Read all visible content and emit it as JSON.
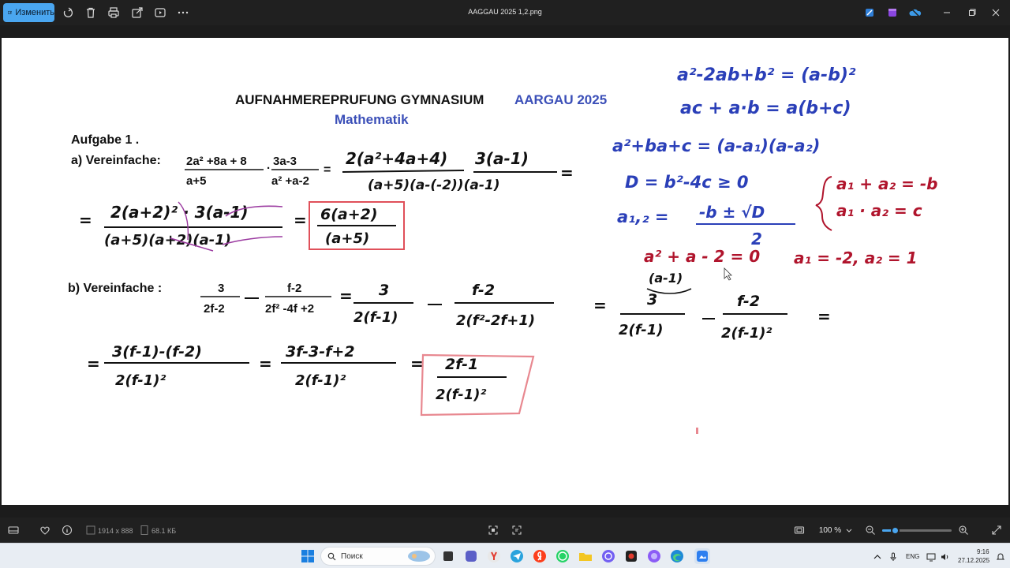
{
  "titlebar": {
    "edit_label": "Изменить",
    "window_title": "AAGGAU 2025 1,2.png"
  },
  "document": {
    "heading": "AUFNAHMEREPRUFUNG GYMNASIUM",
    "heading_accent": "AARGAU 2025",
    "subheading": "Mathematik",
    "task_label": "Aufgabe 1 .",
    "part_a_label": "a) Vereinfache:",
    "part_b_label": "b) Vereinfache :",
    "a_frac1_num": "2a² +8a + 8",
    "a_frac1_den": "a+5",
    "a_frac2_num": "3a-3",
    "a_frac2_den": "a² +a-2",
    "b_frac1_num": "3",
    "b_frac1_den": "2f-2",
    "b_frac2_num": "f-2",
    "b_frac2_den": "2f² -4f +2",
    "hw_a_step1_num": "2(a²+4a+4)",
    "hw_a_step1_frac2_num": "3(a-1)",
    "hw_a_step1_den": "(a+5)(a-(-2))(a-1)",
    "hw_a_step2_num": "2(a+2)² · 3(a-1)",
    "hw_a_step2_den": "(a+5)(a+2)(a-1)",
    "hw_a_result_num": "6(a+2)",
    "hw_a_result_den": "(a+5)",
    "hw_b_step1_f1_num": "3",
    "hw_b_step1_f1_den": "2(f-1)",
    "hw_b_step1_f2_num": "f-2",
    "hw_b_step1_f2_den": "2(f²-2f+1)",
    "hw_b_step2_f1_num": "3",
    "hw_b_step2_f1_den": "2(f-1)",
    "hw_b_step2_f2_num": "f-2",
    "hw_b_step2_f2_den": "2(f-1)²",
    "hw_b_step3_num": "3(f-1)-(f-2)",
    "hw_b_step3_den": "2(f-1)²",
    "hw_b_step4_num": "3f-3-f+2",
    "hw_b_step4_den": "2(f-1)²",
    "hw_b_result_num": "2f-1",
    "hw_b_result_den": "2(f-1)²",
    "note_formula1": "a²-2ab+b² = (a-b)²",
    "note_formula2": "ac + a·b = a(b+c)",
    "note_formula3": "a²+ba+c = (a-a₁)(a-a₂)",
    "note_formula4": "D = b²-4c ≥ 0",
    "note_formula5_lhs": "a₁,₂ =",
    "note_formula5_num": "-b ± √D",
    "note_formula5_den": "2",
    "note_vieta1": "a₁ + a₂ = -b",
    "note_vieta2": "a₁ · a₂ = c",
    "note_solve": "a² + a - 2 = 0",
    "note_roots": "a₁ = -2,  a₂ = 1",
    "note_factor": "(a-1)"
  },
  "bottombar": {
    "dimensions": "1914 x 888",
    "filesize": "68.1 КБ",
    "zoom": "100 %",
    "zoom_fraction": 0.18
  },
  "taskbar": {
    "search_placeholder": "Поиск",
    "lang": "ENG",
    "time": "9:16",
    "date": "27.12.2025"
  },
  "colors": {
    "accent": "#4aa6f0",
    "ink_black": "#111111",
    "ink_blue": "#2a3fb8",
    "ink_red": "#b0142c",
    "box_red": "#e0505a",
    "strike_purple": "#9b3aa0"
  }
}
